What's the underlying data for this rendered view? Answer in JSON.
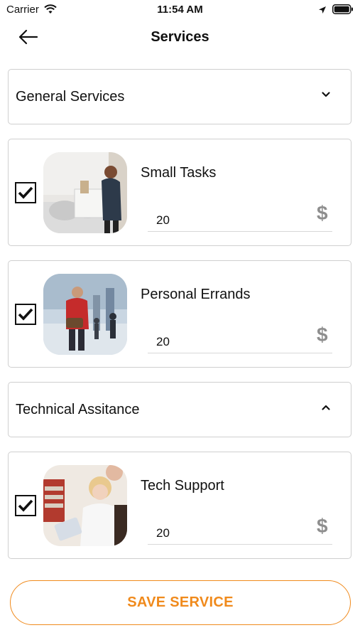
{
  "status_bar": {
    "carrier": "Carrier",
    "time": "11:54 AM",
    "icons": [
      "wifi-icon",
      "location-arrow-icon",
      "battery-icon"
    ]
  },
  "header": {
    "back_icon": "arrow-left-icon",
    "title": "Services"
  },
  "categories": [
    {
      "label": "General Services",
      "expanded": false,
      "chevron": "chevron-down-icon",
      "services": [
        {
          "name": "Small Tasks",
          "checked": true,
          "price": "20",
          "currency_icon": "$",
          "image": "mover-carrying-box-photo"
        },
        {
          "name": "Personal Errands",
          "checked": true,
          "price": "20",
          "currency_icon": "$",
          "image": "person-in-red-jacket-street-photo"
        }
      ]
    },
    {
      "label": "Technical Assitance",
      "expanded": true,
      "chevron": "chevron-up-icon",
      "services": [
        {
          "name": "Tech Support",
          "checked": true,
          "price": "20",
          "currency_icon": "$",
          "image": "woman-with-tablet-photo"
        }
      ]
    }
  ],
  "save_button": {
    "label": "SAVE SERVICE"
  },
  "colors": {
    "accent": "#f08a1c",
    "border": "#cfcfcf",
    "muted_icon": "#8e8e8e"
  }
}
